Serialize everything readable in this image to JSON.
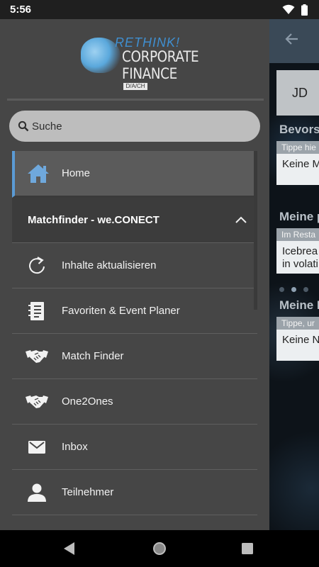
{
  "status": {
    "time": "5:56",
    "wifi_icon": "wifi-icon",
    "battery_icon": "battery-icon"
  },
  "logo": {
    "rethink": "RETHINK!",
    "line1": "CORPORATE",
    "line2": "FINANCE",
    "region": "D/A/CH"
  },
  "search": {
    "placeholder": "Suche",
    "value": ""
  },
  "menu": {
    "home": {
      "label": "Home",
      "icon": "home-icon"
    },
    "section": {
      "label": "Matchfinder - we.CONECT",
      "icon": "chevron-up-icon"
    },
    "items": [
      {
        "label": "Inhalte aktualisieren",
        "icon": "refresh-icon"
      },
      {
        "label": "Favoriten & Event Planer",
        "icon": "planner-icon"
      },
      {
        "label": "Match Finder",
        "icon": "handshake-icon"
      },
      {
        "label": "One2Ones",
        "icon": "handshake-icon"
      },
      {
        "label": "Inbox",
        "icon": "mail-icon"
      },
      {
        "label": "Teilnehmer",
        "icon": "person-icon"
      }
    ]
  },
  "background_app": {
    "back_icon": "arrow-back-icon",
    "avatar": "JD",
    "heading1": "Bevorst",
    "card1_sub": "Tippe hie",
    "card1_body": "Keine M",
    "heading2": "Meine p",
    "card2_sub": "Im Resta",
    "card2_body1": "Icebrea",
    "card2_body2": "in volati",
    "heading3": "Meine I",
    "card3_sub": "Tippe, ur",
    "card3_body": "Keine N"
  },
  "colors": {
    "drawer": "#464646",
    "accent": "#5b9bd5",
    "home_highlight": "#5b5b5b",
    "section_header": "#3c3c3c"
  }
}
